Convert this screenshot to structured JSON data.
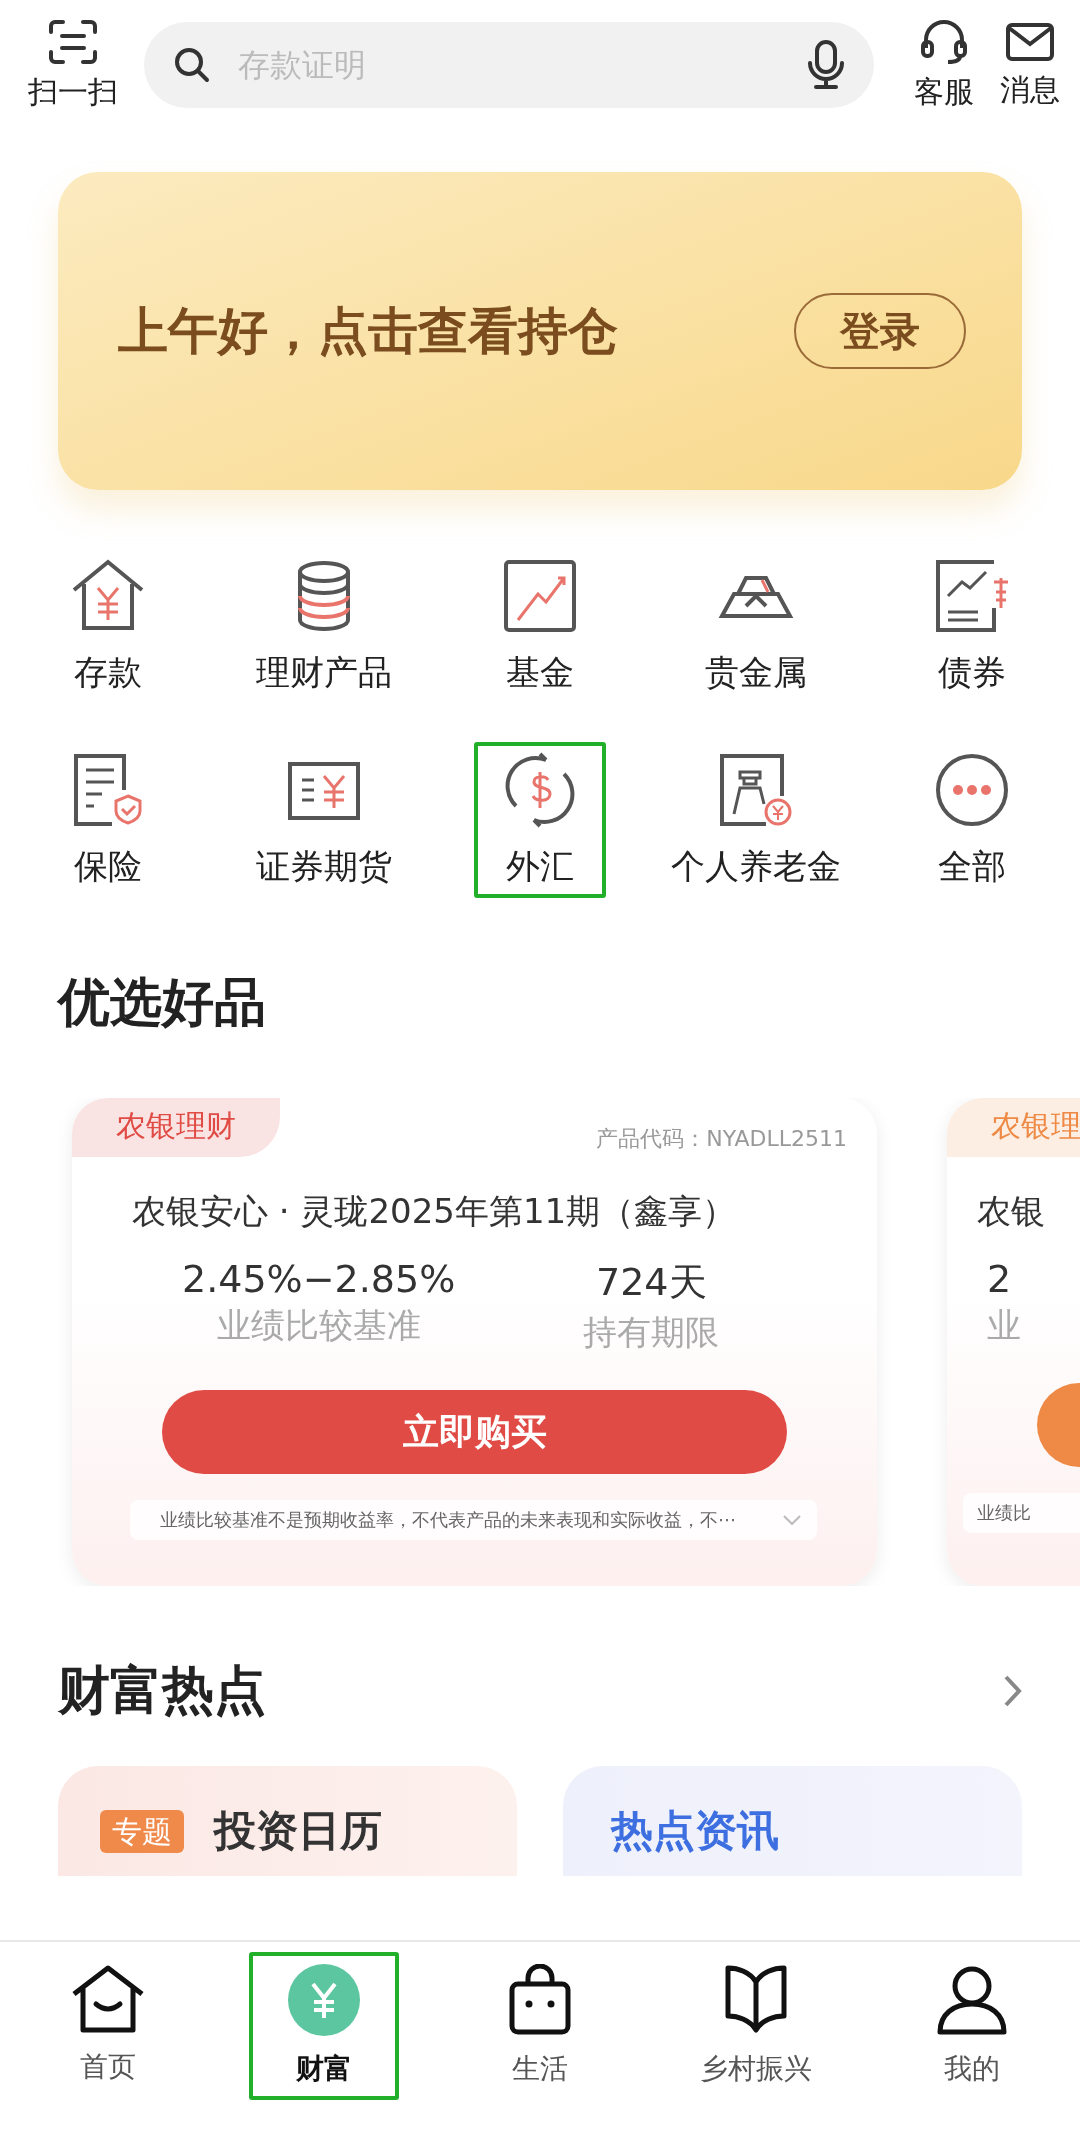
{
  "top_bar": {
    "scan_label": "扫一扫",
    "search": {
      "placeholder": "存款证明"
    },
    "service_label": "客服",
    "messages_label": "消息"
  },
  "banner": {
    "greeting": "上午好，点击查看持仓",
    "login_button": "登录"
  },
  "categories": [
    {
      "label": "存款",
      "kind": "deposit",
      "highlighted": false
    },
    {
      "label": "理财产品",
      "kind": "coins",
      "highlighted": false
    },
    {
      "label": "基金",
      "kind": "fund",
      "highlighted": false
    },
    {
      "label": "贵金属",
      "kind": "metal",
      "highlighted": false
    },
    {
      "label": "债券",
      "kind": "bond",
      "highlighted": false
    },
    {
      "label": "保险",
      "kind": "insurance",
      "highlighted": false
    },
    {
      "label": "证券期货",
      "kind": "securities",
      "highlighted": false
    },
    {
      "label": "外汇",
      "kind": "forex",
      "highlighted": true
    },
    {
      "label": "个人养老金",
      "kind": "pension",
      "highlighted": false
    },
    {
      "label": "全部",
      "kind": "more",
      "highlighted": false
    }
  ],
  "featured": {
    "title": "优选好品",
    "products": [
      {
        "tag": "农银理财",
        "code": "产品代码：NYADLL2511",
        "name": "农银安心 · 灵珑2025年第11期（鑫享）",
        "rate": "2.45%−2.85%",
        "rate_label": "业绩比较基准",
        "term": "724天",
        "term_label": "持有期限",
        "buy_button": "立即购买",
        "disclaimer": "业绩比较基准不是预期收益率，不代表产品的未来表现和实际收益，不⋯",
        "color": "#e04b45"
      },
      {
        "tag": "农银理",
        "name": "农银",
        "rate": "2",
        "rate_label": "业",
        "disclaimer": "业绩比",
        "color": "#ee8a45"
      }
    ]
  },
  "hot": {
    "title": "财富热点",
    "cards": [
      {
        "badge": "专题",
        "title": "投资日历"
      },
      {
        "title": "热点资讯"
      }
    ]
  },
  "bottom_nav": [
    {
      "label": "首页",
      "kind": "home",
      "selected": false,
      "highlighted": false
    },
    {
      "label": "财富",
      "kind": "wealth",
      "selected": true,
      "highlighted": true
    },
    {
      "label": "生活",
      "kind": "bag",
      "selected": false,
      "highlighted": false
    },
    {
      "label": "乡村振兴",
      "kind": "book",
      "selected": false,
      "highlighted": false
    },
    {
      "label": "我的",
      "kind": "person",
      "selected": false,
      "highlighted": false
    }
  ]
}
